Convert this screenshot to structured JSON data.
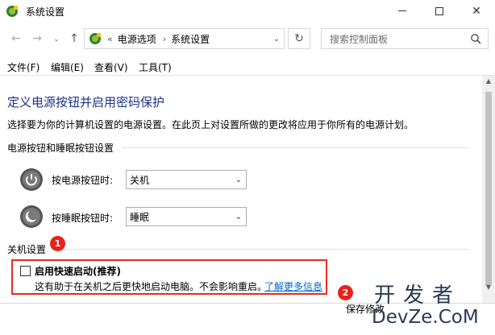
{
  "window": {
    "title": "系统设置",
    "minimize_glyph": "",
    "close_glyph": "✕"
  },
  "nav": {
    "back_glyph": "←",
    "forward_glyph": "→",
    "dropdown_glyph": "⌄",
    "up_glyph": "↑",
    "chevrons": "«",
    "breadcrumb": [
      "电源选项",
      "系统设置"
    ],
    "separator": "›",
    "addr_dropdown_glyph": "⌄",
    "refresh_glyph": "↻",
    "search_placeholder": "搜索控制面板"
  },
  "menu": [
    "文件(F)",
    "编辑(E)",
    "查看(V)",
    "工具(T)"
  ],
  "content": {
    "title": "定义电源按钮并启用密码保护",
    "description": "选择要为你的计算机设置的电源设置。在此页上对设置所做的更改将应用于你所有的电源计划。",
    "section1": "电源按钮和睡眠按钮设置",
    "power_button_label": "按电源按钮时:",
    "power_button_value": "关机",
    "sleep_button_label": "按睡眠按钮时:",
    "sleep_button_value": "睡眠",
    "section2": "关机设置",
    "fast_startup_label": "启用快速启动(推荐)",
    "fast_startup_desc": "这有助于在关机之后更快地启动电脑。不会影响重启。",
    "learn_more": "了解更多信息",
    "fast_startup_checked": false,
    "save_button": "保存修改"
  },
  "annotations": {
    "badge1": "1",
    "badge2": "2"
  },
  "watermark": {
    "cn": "开发者",
    "en": "DevZe.CoM"
  },
  "scroll": {
    "up_glyph": "▲",
    "down_glyph": "▼"
  },
  "colors": {
    "title_blue": "#1e3287",
    "link_blue": "#0066cc",
    "highlight_red": "#e82a25"
  }
}
